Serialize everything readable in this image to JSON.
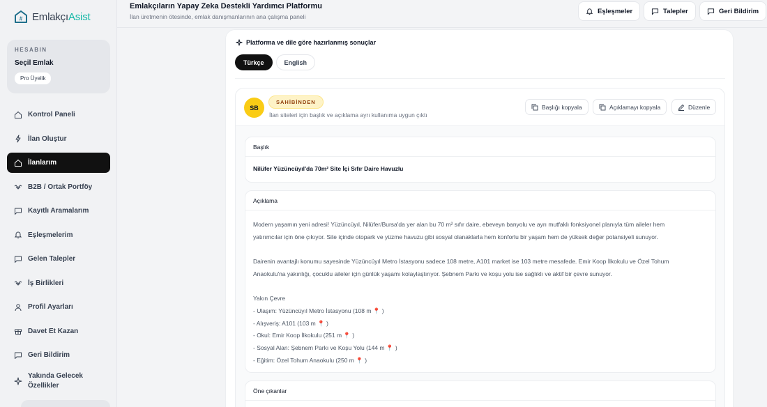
{
  "brand": {
    "name_part1": "Emlakçı",
    "name_part2": "Asist"
  },
  "account": {
    "label": "HESABIN",
    "name": "Seçil Emlak",
    "plan": "Pro Üyelik"
  },
  "nav": [
    {
      "label": "Kontrol Paneli",
      "icon": "home-icon"
    },
    {
      "label": "İlan Oluştur",
      "icon": "bolt-icon"
    },
    {
      "label": "İlanlarım",
      "icon": "home-icon",
      "active": true
    },
    {
      "label": "B2B / Ortak Portföy",
      "icon": "handshake-icon"
    },
    {
      "label": "Kayıtlı Aramalarım",
      "icon": "chat-icon"
    },
    {
      "label": "Eşleşmelerim",
      "icon": "bell-icon"
    },
    {
      "label": "Gelen Talepler",
      "icon": "chat-icon"
    },
    {
      "label": "İş Birlikleri",
      "icon": "handshake-icon"
    },
    {
      "label": "Profil Ayarları",
      "icon": "user-icon"
    },
    {
      "label": "Davet Et Kazan",
      "icon": "gift-icon"
    },
    {
      "label": "Geri Bildirim",
      "icon": "chat-icon"
    },
    {
      "label": "Yakında Gelecek Özellikler",
      "icon": "sparkle-icon"
    }
  ],
  "header": {
    "title": "Emlakçıların Yapay Zeka Destekli Yardımcı Platformu",
    "subtitle": "İlan üretmenin ötesinde, emlak danışmanlarının ana çalışma paneli",
    "buttons": {
      "matches": "Eşleşmeler",
      "requests": "Talepler",
      "feedback": "Geri Bildirim"
    }
  },
  "main": {
    "section_title": "Platforma ve dile göre hazırlanmış sonuçlar",
    "tabs": [
      "Türkçe",
      "English"
    ],
    "active_tab": "Türkçe",
    "result": {
      "avatar": "SB",
      "platform": "SAHİBİNDEN",
      "platform_desc": "İlan siteleri için başlık ve açıklama ayrı kullanıma uygun çıktı",
      "actions": {
        "copy_title": "Başlığı kopyala",
        "copy_desc": "Açıklamayı kopyala",
        "edit": "Düzenle"
      },
      "title_label": "Başlık",
      "title_value": "Nilüfer Yüzüncüyıl'da 70m² Site İçi Sıfır Daire Havuzlu",
      "desc_label": "Açıklama",
      "desc_lines": [
        "Modern yaşamın yeni adresi! Yüzüncüyıl, Nilüfer/Bursa'da yer alan bu 70 m² sıfır daire, ebeveyn banyolu ve ayrı mutfaklı fonksiyonel planıyla tüm aileler hem",
        "yatırımcılar için öne çıkıyor. Site içinde otopark ve yüzme havuzu gibi sosyal olanaklarla hem konforlu bir yaşam hem de yüksek değer potansiyeli sunuyor.",
        "",
        "Dairenin avantajlı konumu sayesinde Yüzüncüyıl Metro İstasyonu sadece 108 metre, A101 market ise 103 metre mesafede. Emir Koop İlkokulu ve Özel Tohum",
        "Anaokulu'na yakınlığı, çocuklu aileler için günlük yaşamı kolaylaştırıyor. Şebnem Parkı ve koşu yolu ise sağlıklı ve aktif bir çevre sunuyor.",
        "",
        "Yakın Çevre",
        "- Ulaşım: Yüzüncüyıl Metro İstasyonu (108 m 📍 )",
        "- Alışveriş: A101 (103 m 📍 )",
        "- Okul: Emir Koop İlkokulu (251 m 📍 )",
        "- Sosyal Alan: Şebnem Parkı ve Koşu Yolu (144 m 📍 )",
        "- Eğitim: Özel Tohum Anaokulu (250 m 📍 )"
      ],
      "highlights_label": "Öne çıkanlar"
    }
  },
  "colors": {
    "accent": "#14b8a6",
    "active_nav": "#111111",
    "badge_bg": "#fef3c7",
    "avatar": "#facc15"
  }
}
